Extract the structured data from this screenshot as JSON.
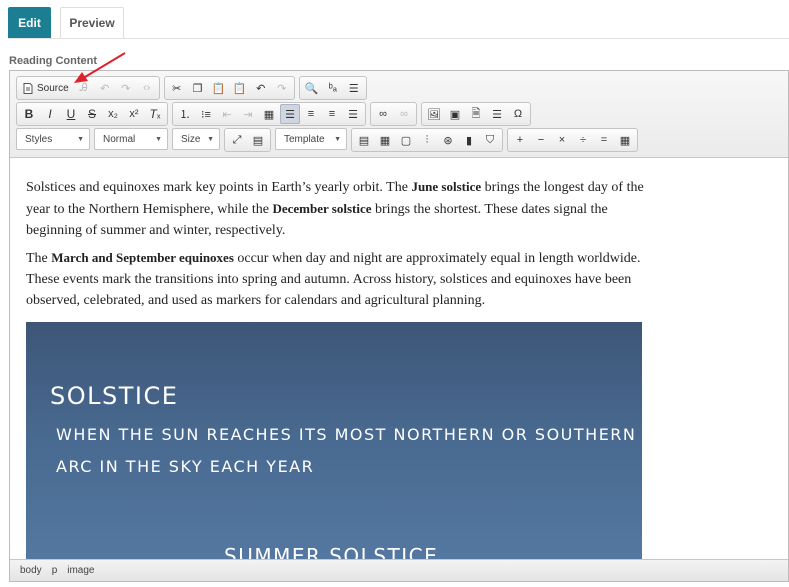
{
  "tabs": [
    {
      "label": "Edit",
      "active": true
    },
    {
      "label": "Preview",
      "active": false
    }
  ],
  "field_label": "Reading Content",
  "toolbar": {
    "source_label": "Source",
    "styles_label": "Styles",
    "format_label": "Normal",
    "size_label": "Size",
    "template_label": "Template"
  },
  "content": {
    "p1_a": "Solstices and equinoxes mark key points in Earth’s yearly orbit. The ",
    "p1_b": "June solstice",
    "p1_c": " brings the longest day of the year to the Northern Hemisphere, while the ",
    "p1_d": "December solstice",
    "p1_e": " brings the shortest. These dates signal the beginning of summer and winter, respectively.",
    "p2_a": "The ",
    "p2_b": "March and September equinoxes",
    "p2_c": " occur when day and night are approximately equal in length worldwide. These events mark the transitions into spring and autumn. Across history, solstices and equinoxes have been observed, celebrated, and used as markers for calendars and agricultural planning."
  },
  "image": {
    "title": "SOLSTICE",
    "line1": "WHEN THE SUN REACHES ITS MOST NORTHERN OR SOUTHERN",
    "line2": "ARC IN THE SKY EACH YEAR",
    "subtitle": "SUMMER SOLSTICE"
  },
  "statusbar": {
    "path": [
      "body",
      "p",
      "image"
    ]
  },
  "colors": {
    "accent": "#1c7e93",
    "annotation_arrow": "#e0202a",
    "image_bg": "#496a91"
  }
}
